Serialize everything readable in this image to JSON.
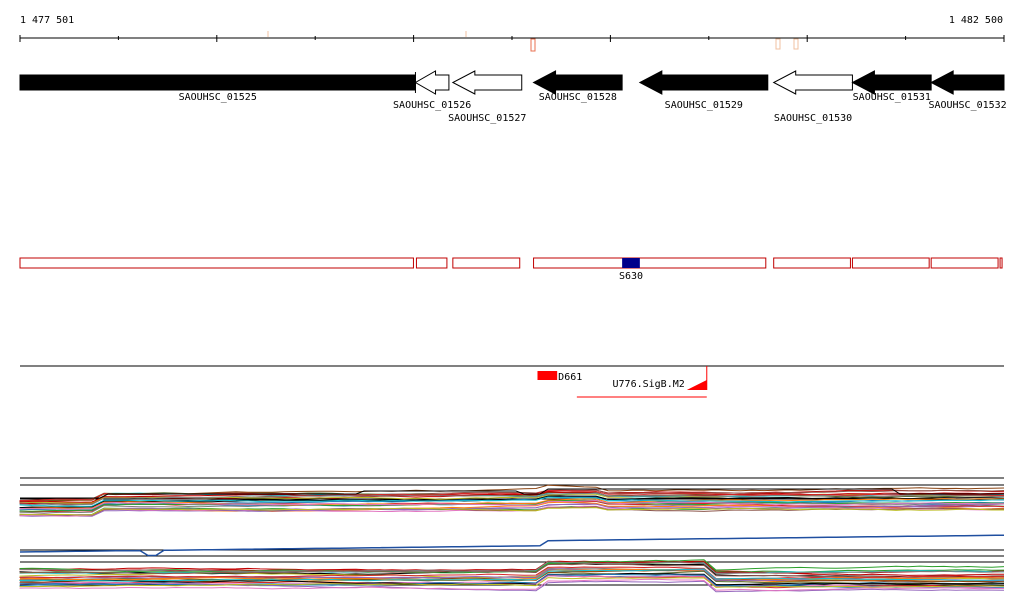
{
  "coords": {
    "start_label": "1 477 501",
    "end_label": "1 482 500",
    "start": 1477501,
    "end": 1482500
  },
  "genes": [
    {
      "name": "SAOUHSC_01525",
      "start": 1477501,
      "end": 1479510,
      "strand": "+",
      "fill": "black"
    },
    {
      "name": "SAOUHSC_01526",
      "start": 1479510,
      "end": 1479680,
      "strand": "-",
      "fill": "white"
    },
    {
      "name": "SAOUHSC_01527",
      "start": 1479700,
      "end": 1480050,
      "strand": "-",
      "fill": "white"
    },
    {
      "name": "SAOUHSC_01528",
      "start": 1480110,
      "end": 1480560,
      "strand": "-",
      "fill": "black"
    },
    {
      "name": "SAOUHSC_01529",
      "start": 1480650,
      "end": 1481300,
      "strand": "-",
      "fill": "black"
    },
    {
      "name": "SAOUHSC_01530",
      "start": 1481330,
      "end": 1481730,
      "strand": "-",
      "fill": "white"
    },
    {
      "name": "SAOUHSC_01531",
      "start": 1481730,
      "end": 1482130,
      "strand": "-",
      "fill": "black"
    },
    {
      "name": "SAOUHSC_01532",
      "start": 1482130,
      "end": 1482500,
      "strand": "-",
      "fill": "black"
    }
  ],
  "segments": [
    {
      "start": 1477501,
      "end": 1479510
    },
    {
      "start": 1479515,
      "end": 1479680
    },
    {
      "start": 1479700,
      "end": 1480050
    },
    {
      "start": 1480110,
      "end": 1481300
    },
    {
      "start": 1481330,
      "end": 1481730
    },
    {
      "start": 1481730,
      "end": 1482130
    },
    {
      "start": 1482130,
      "end": 1482480
    },
    {
      "start": 1482480,
      "end": 1482500
    }
  ],
  "features": [
    {
      "name": "S630",
      "start": 1480560,
      "end": 1480650,
      "color": "#00008b"
    }
  ],
  "transcripts": [
    {
      "name": "D661",
      "start": 1480130,
      "end": 1480230,
      "color": "#ff0000"
    },
    {
      "name": "U776.SigB.M2",
      "start": 1480330,
      "end": 1480990,
      "color": "#ff0000"
    }
  ],
  "colors": {
    "segment_outline": "#c00000",
    "mark": "#e87050",
    "track": "#000000"
  }
}
